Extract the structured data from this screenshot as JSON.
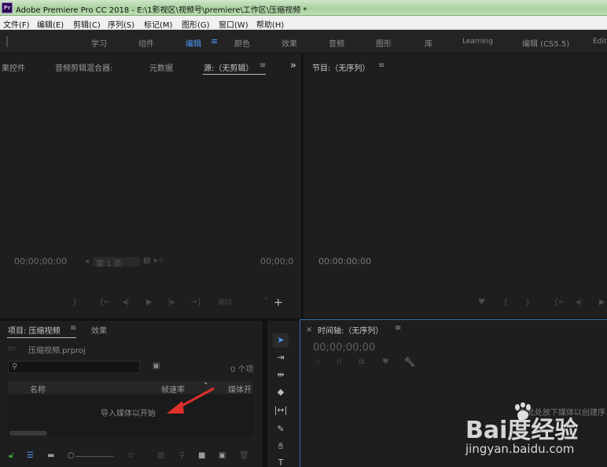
{
  "window": {
    "app_icon": "Pr",
    "title": "Adobe Premiere Pro CC 2018 - E:\\1影视区\\视频号\\premiere\\工作区\\压缩视频 *"
  },
  "menu": [
    "文件(F)",
    "编辑(E)",
    "剪辑(C)",
    "序列(S)",
    "标记(M)",
    "图形(G)",
    "窗口(W)",
    "帮助(H)"
  ],
  "workspaces": {
    "items": [
      "学习",
      "组件",
      "编辑",
      "颜色",
      "效果",
      "音频",
      "图形",
      "库",
      "Learning",
      "编辑 (CS5.5)",
      "Edit"
    ],
    "active": "编辑",
    "menu_glyph": "≡"
  },
  "source_panel": {
    "tabs": [
      "果控件",
      "音频剪辑混合器:",
      "元数据",
      "源:（无剪辑）"
    ],
    "menu_glyph": "≡",
    "overflow": "»",
    "timecode_left": "00;00;00;00",
    "timecode_right": "00;00;0",
    "zoom_select": "第 1 页",
    "add_button": "+"
  },
  "program_panel": {
    "title": "节目:（无序列）",
    "menu_glyph": "≡",
    "timecode": "00:00:00:00"
  },
  "project_panel": {
    "title": "项目: 压缩视频",
    "menu_glyph": "≡",
    "effects_tab": "效果",
    "file_name": "压缩视频.prproj",
    "item_count": "0 个项",
    "columns": [
      "名称",
      "帧速率",
      "媒体开"
    ],
    "empty_message": "导入媒体以开始"
  },
  "timeline_panel": {
    "close": "×",
    "title": "时间轴:（无序列）",
    "menu_glyph": "≡",
    "timecode": "00;00;00;00",
    "drop_hint": "在此处放下媒体以创建序"
  },
  "watermark": {
    "logo": "Bai度经验",
    "url": "jingyan.baidu.com"
  },
  "colors": {
    "accent": "#4d9dff",
    "panel_bg": "#1e1e1e",
    "annotation_arrow": "#e0302a"
  }
}
